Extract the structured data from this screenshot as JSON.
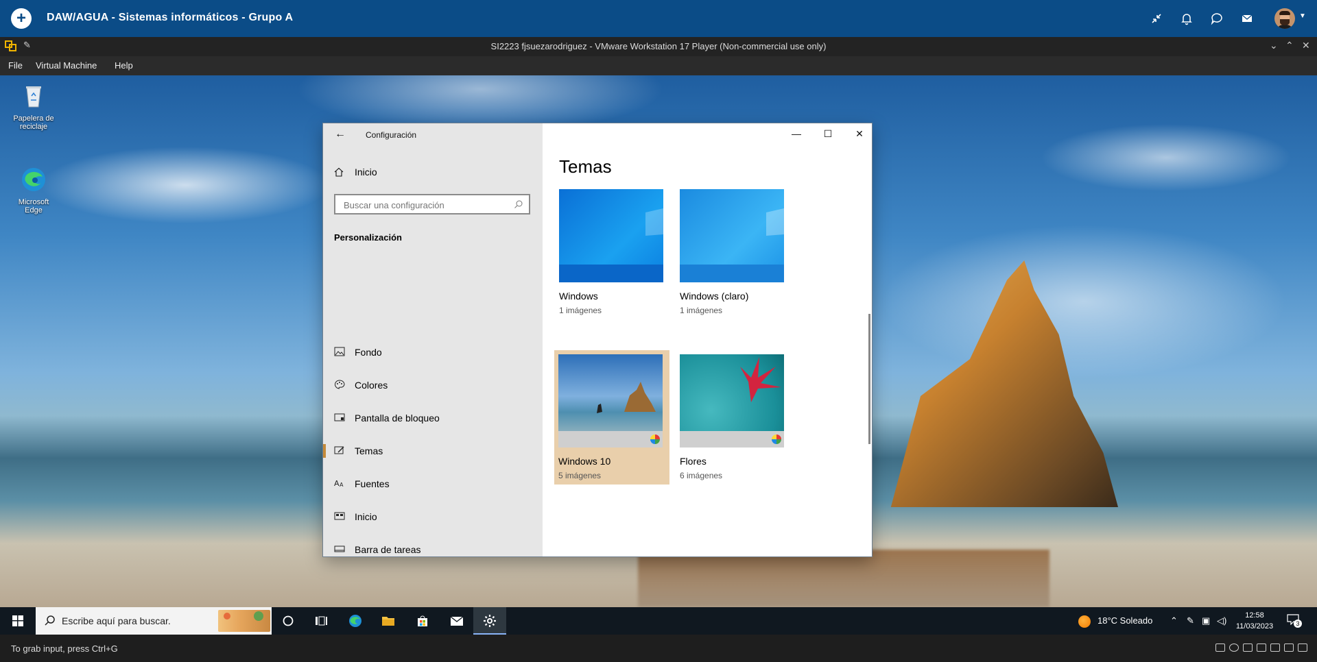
{
  "top_bar": {
    "title": "DAW/AGUA - Sistemas informáticos - Grupo A",
    "icons": [
      "add-icon",
      "minimize-arrows-icon",
      "bell-icon",
      "chat-icon",
      "mail-icon",
      "avatar"
    ]
  },
  "vmware": {
    "window_title": "SI2223 fjsuezarodriguez - VMware Workstation 17 Player (Non-commercial use only)",
    "menu": [
      "File",
      "Virtual Machine",
      "Help"
    ],
    "status_message": "To grab input, press Ctrl+G"
  },
  "desktop": {
    "icons": [
      {
        "label": "Papelera de reciclaje",
        "icon": "recycle-bin-icon"
      },
      {
        "label": "Microsoft Edge",
        "icon": "edge-icon"
      }
    ]
  },
  "settings": {
    "app_title": "Configuración",
    "home_label": "Inicio",
    "search_placeholder": "Buscar una configuración",
    "section": "Personalización",
    "nav": [
      {
        "label": "Fondo",
        "icon": "picture-icon"
      },
      {
        "label": "Colores",
        "icon": "palette-icon"
      },
      {
        "label": "Pantalla de bloqueo",
        "icon": "lock-screen-icon"
      },
      {
        "label": "Temas",
        "icon": "brush-icon",
        "selected": true
      },
      {
        "label": "Fuentes",
        "icon": "font-icon"
      },
      {
        "label": "Inicio",
        "icon": "start-icon"
      },
      {
        "label": "Barra de tareas",
        "icon": "taskbar-icon"
      }
    ],
    "heading": "Temas",
    "themes": [
      {
        "name": "Windows",
        "count": "1 imágenes"
      },
      {
        "name": "Windows (claro)",
        "count": "1 imágenes"
      },
      {
        "name": "Windows 10",
        "count": "5 imágenes",
        "selected": true
      },
      {
        "name": "Flores",
        "count": "6 imágenes"
      }
    ]
  },
  "taskbar": {
    "search_placeholder": "Escribe aquí para buscar.",
    "weather": "18°C  Soleado",
    "time": "12:58",
    "date": "11/03/2023",
    "notification_count": "3"
  },
  "colors": {
    "top_bar": "#0b4c87",
    "selected_tile": "#e9cfab",
    "selection_accent": "#c48a3a"
  }
}
